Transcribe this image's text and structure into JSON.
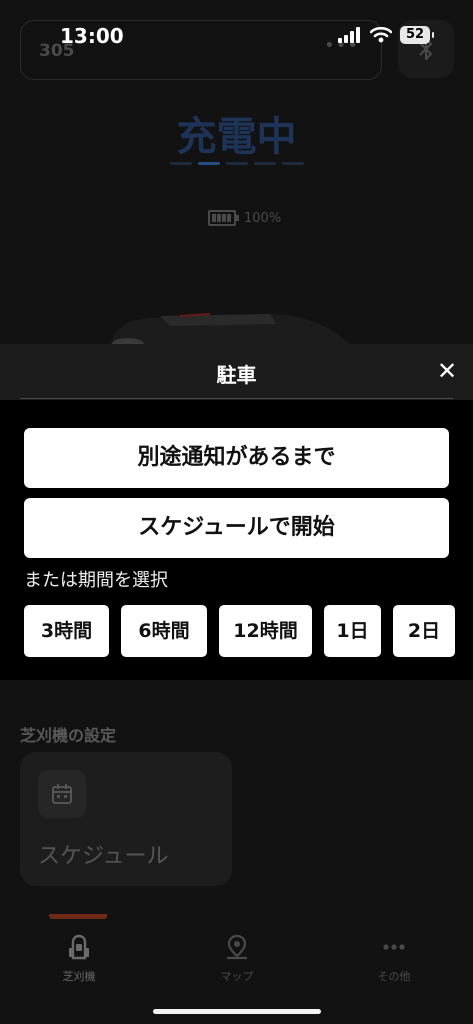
{
  "status_bar": {
    "time": "13:00",
    "battery": "52"
  },
  "header": {
    "mower_code": "305",
    "more_glyph": "•••"
  },
  "mower_status": {
    "title": "充電中",
    "battery_percent": "100%",
    "progress_step": 2,
    "progress_steps": 5
  },
  "sheet": {
    "title": "駐車",
    "close_glyph": "✕",
    "option_until_further_notice": "別途通知があるまで",
    "option_start_with_schedule": "スケジュールで開始",
    "choose_period_label": "または期間を選択",
    "durations": [
      "3時間",
      "6時間",
      "12時間",
      "1日",
      "2日"
    ]
  },
  "settings": {
    "title": "芝刈機の設定",
    "schedule_label": "スケジュール"
  },
  "tabbar": {
    "items": [
      {
        "label": "芝刈機"
      },
      {
        "label": "マップ"
      },
      {
        "label": "その他"
      }
    ],
    "active_index": 0
  },
  "colors": {
    "status_blue": "#1d3358",
    "sheet_bg": "#000000",
    "button_bg": "#ffffff",
    "tab_indicator": "#6e2a16"
  },
  "icons": {
    "bluetooth": "bluetooth-icon",
    "schedule": "calendar-icon",
    "mower_tab": "mower-icon",
    "map_tab": "map-pin-icon",
    "more_tab": "more-dots-icon"
  }
}
